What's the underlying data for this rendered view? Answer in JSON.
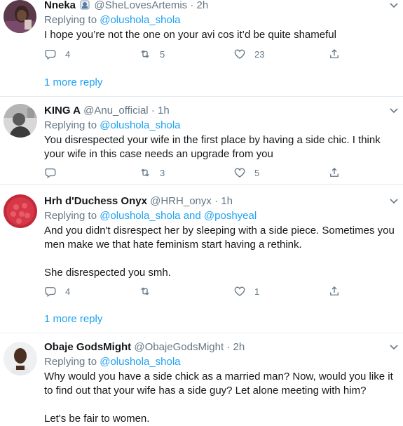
{
  "tweets": [
    {
      "name": "Nneka",
      "handle": "@SheLovesArtemis",
      "time": "2h",
      "replying_label": "Replying to",
      "mentions": [
        "@olushola_shola"
      ],
      "mention_join": "",
      "text": [
        "I hope you’re not the one on your avi cos it’d be quite shameful"
      ],
      "replies": "4",
      "retweets": "5",
      "likes": "23",
      "more_replies": "1 more reply"
    },
    {
      "name": "KING A",
      "handle": "@Anu_official",
      "time": "1h",
      "replying_label": "Replying to",
      "mentions": [
        "@olushola_shola"
      ],
      "mention_join": "",
      "text": [
        "You disrespected your wife in the first place by having a side chic. I think your wife in this case needs an upgrade from you"
      ],
      "replies": "",
      "retweets": "3",
      "likes": "5"
    },
    {
      "name": "Hrh d'Duchess Onyx",
      "handle": "@HRH_onyx",
      "time": "1h",
      "replying_label": "Replying to",
      "mentions": [
        "@olushola_shola",
        "@poshyeal"
      ],
      "mention_join": "and",
      "text": [
        "And you didn't disrespect her by sleeping with a side piece. Sometimes you men make we that hate feminism start having a rethink.",
        "She disrespected you smh."
      ],
      "replies": "4",
      "retweets": "",
      "likes": "1",
      "more_replies": "1 more reply"
    },
    {
      "name": "Obaje GodsMight",
      "handle": "@ObajeGodsMight",
      "time": "2h",
      "replying_label": "Replying to",
      "mentions": [
        "@olushola_shola"
      ],
      "mention_join": "",
      "text": [
        "Why would you have a side chick as a married man? Now, would you like it to find out that your wife has a side guy? Let alone meeting with him?",
        "Let's be fair to women."
      ]
    }
  ],
  "icons": {
    "reply": "reply-icon",
    "retweet": "retweet-icon",
    "like": "heart-icon",
    "share": "share-icon",
    "menu": "chevron-down-icon"
  },
  "colors": {
    "link": "#1da1f2",
    "secondary": "#657786",
    "divider": "#e6ecf0"
  }
}
